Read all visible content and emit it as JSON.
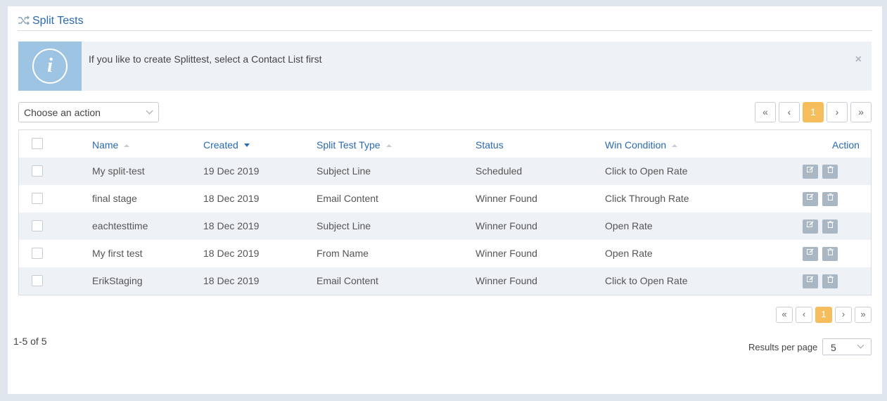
{
  "header": {
    "title": "Split Tests",
    "icon": "shuffle-icon"
  },
  "alert": {
    "message": "If you like to create Splittest, select a Contact List first",
    "icon": "info-icon",
    "close": "×"
  },
  "action_select": {
    "value": "Choose an action"
  },
  "pagination": {
    "first": "«",
    "prev": "‹",
    "current": "1",
    "next": "›",
    "last": "»"
  },
  "table": {
    "columns": {
      "name": "Name",
      "created": "Created",
      "type": "Split Test Type",
      "status": "Status",
      "win": "Win Condition",
      "action": "Action"
    },
    "rows": [
      {
        "name": "My split-test",
        "created": "19 Dec 2019",
        "type": "Subject Line",
        "status": "Scheduled",
        "win": "Click to Open Rate"
      },
      {
        "name": "final stage",
        "created": "18 Dec 2019",
        "type": "Email Content",
        "status": "Winner Found",
        "win": "Click Through Rate"
      },
      {
        "name": "eachtesttime",
        "created": "18 Dec 2019",
        "type": "Subject Line",
        "status": "Winner Found",
        "win": "Open Rate"
      },
      {
        "name": "My first test",
        "created": "18 Dec 2019",
        "type": "From Name",
        "status": "Winner Found",
        "win": "Open Rate"
      },
      {
        "name": "ErikStaging",
        "created": "18 Dec 2019",
        "type": "Email Content",
        "status": "Winner Found",
        "win": "Click to Open Rate"
      }
    ]
  },
  "footer": {
    "count": "1-5 of 5",
    "results_per_page_label": "Results per page",
    "results_per_page_value": "5"
  },
  "colors": {
    "accent": "#2a6ab0",
    "pager_active": "#f6bd5c",
    "info_box": "#9ec4e4",
    "alt_row": "#eef2f6"
  }
}
